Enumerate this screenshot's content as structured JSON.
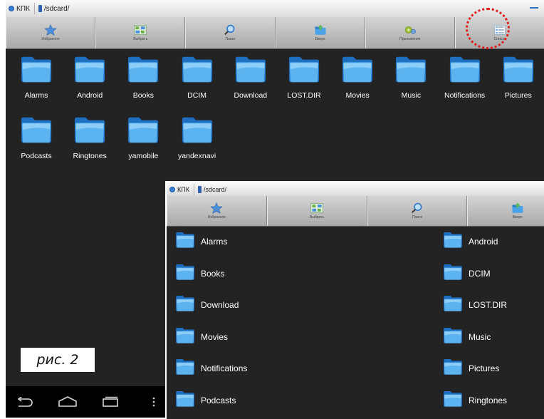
{
  "main_window": {
    "title": "КПК",
    "path": "/sdcard/",
    "toolbar": [
      {
        "name": "favorites",
        "label": "Избранное",
        "icon": "star-icon"
      },
      {
        "name": "select",
        "label": "Выбрать",
        "icon": "select-grid-icon"
      },
      {
        "name": "search",
        "label": "Поиск",
        "icon": "search-icon"
      },
      {
        "name": "up",
        "label": "Вверх",
        "icon": "folder-up-icon"
      },
      {
        "name": "apps",
        "label": "Приложения",
        "icon": "gears-icon"
      },
      {
        "name": "list",
        "label": "Список",
        "icon": "list-view-icon"
      }
    ],
    "folders": [
      "Alarms",
      "Android",
      "Books",
      "DCIM",
      "Download",
      "LOST.DIR",
      "Movies",
      "Music",
      "Notifications",
      "Pictures",
      "Podcasts",
      "Ringtones",
      "yamobile",
      "yandexnavi"
    ]
  },
  "inset_window": {
    "title": "КПК",
    "path": "/sdcard/",
    "toolbar": [
      {
        "name": "favorites",
        "label": "Избранное",
        "icon": "star-icon"
      },
      {
        "name": "select",
        "label": "Выбрать",
        "icon": "select-grid-icon"
      },
      {
        "name": "search",
        "label": "Поиск",
        "icon": "search-icon"
      },
      {
        "name": "up",
        "label": "Вверх",
        "icon": "folder-up-icon"
      }
    ],
    "list_left": [
      "Alarms",
      "Books",
      "Download",
      "Movies",
      "Notifications",
      "Podcasts"
    ],
    "list_right": [
      "Android",
      "DCIM",
      "LOST.DIR",
      "Music",
      "Pictures",
      "Ringtones"
    ]
  },
  "caption": "рис. 2",
  "colors": {
    "background": "#232323",
    "folder": "#4aa3e8",
    "highlight_circle": "#e01c1c"
  }
}
